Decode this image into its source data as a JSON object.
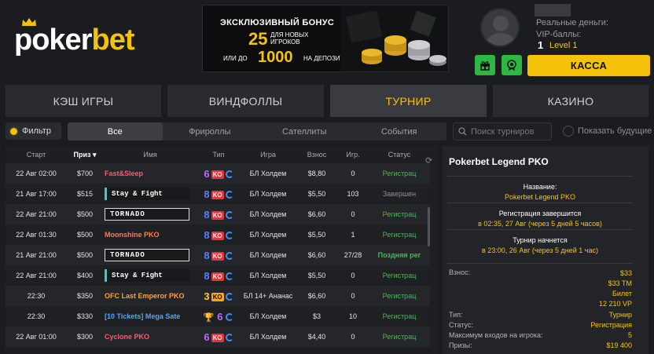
{
  "brand": {
    "logo_part1": "poker",
    "logo_part2": "bet",
    "accent": "#f5c20a",
    "green": "#2fb743"
  },
  "banner": {
    "line1": "ЭКСКЛЮЗИВНЫЙ БОНУС",
    "amount1": "25",
    "amount1_desc": "ДЛЯ НОВЫХ ИГРОКОВ",
    "prefix2": "ИЛИ ДО",
    "amount2": "1000",
    "amount2_desc": "НА ДЕПОЗИТ"
  },
  "account": {
    "money_label": "Реальные деньги:",
    "vip_label": "VIP-баллы:",
    "vip_points": "1",
    "level": "Level 1",
    "kassa_label": "КАССА",
    "gift_icon": "gift-icon",
    "badge_icon": "badge-icon"
  },
  "nav": {
    "tabs": [
      {
        "label": "КЭШ ИГРЫ"
      },
      {
        "label": "ВИНДФОЛЛЫ"
      },
      {
        "label": "ТУРНИР"
      },
      {
        "label": "КАЗИНО"
      }
    ],
    "active": "ТУРНИР"
  },
  "filter": {
    "label": "Фильтр",
    "subtabs": [
      "Все",
      "Фрироллы",
      "Сателлиты",
      "События"
    ],
    "active_subtab": "Все",
    "search_placeholder": "Поиск турниров",
    "show_future": "Показать будущие"
  },
  "table": {
    "columns": [
      "Старт",
      "Приз",
      "Имя",
      "Тип",
      "Игра",
      "Взнос",
      "Игр.",
      "Статус"
    ],
    "sort_column": "Приз",
    "rows": [
      {
        "start": "22 Авг 02:00",
        "prize": "$700",
        "name": "Fast&Sleep",
        "type_num": "6",
        "type_flags": "KO",
        "game": "БЛ Холдем",
        "buyin": "$8,80",
        "players": "0",
        "status": "Регистрац"
      },
      {
        "start": "21 Авг 17:00",
        "prize": "$515",
        "name": "Stay & Fight",
        "type_num": "8",
        "type_flags": "KO",
        "game": "БЛ Холдем",
        "buyin": "$5,50",
        "players": "103",
        "status": "Завершен"
      },
      {
        "start": "22 Авг 21:00",
        "prize": "$500",
        "name": "TORNADO",
        "type_num": "8",
        "type_flags": "KO",
        "game": "БЛ Холдем",
        "buyin": "$6,60",
        "players": "0",
        "status": "Регистрац"
      },
      {
        "start": "22 Авг 01:30",
        "prize": "$500",
        "name": "Moonshine PKO",
        "type_num": "8",
        "type_flags": "KO",
        "game": "БЛ Холдем",
        "buyin": "$5,50",
        "players": "1",
        "status": "Регистрац"
      },
      {
        "start": "21 Авг 21:00",
        "prize": "$500",
        "name": "TORNADO",
        "type_num": "8",
        "type_flags": "KO",
        "game": "БЛ Холдем",
        "buyin": "$6,60",
        "players": "27/28",
        "status": "Поздняя рег"
      },
      {
        "start": "22 Авг 21:00",
        "prize": "$400",
        "name": "Stay & Fight",
        "type_num": "8",
        "type_flags": "KO",
        "game": "БЛ Холдем",
        "buyin": "$5,50",
        "players": "0",
        "status": "Регистрац"
      },
      {
        "start": "22:30",
        "prize": "$350",
        "name": "OFC Last Emperor PKO",
        "type_num": "3",
        "type_flags": "KO",
        "game": "БЛ 14+ Ананас",
        "buyin": "$6,60",
        "players": "0",
        "status": "Регистрац"
      },
      {
        "start": "22:30",
        "prize": "$330",
        "name": "[10 Tickets] Mega Sate",
        "type_num": "6",
        "type_flags": "",
        "game": "БЛ Холдем",
        "buyin": "$3",
        "players": "10",
        "status": "Регистрац"
      },
      {
        "start": "22 Авг 01:00",
        "prize": "$300",
        "name": "Cyclone PKO",
        "type_num": "6",
        "type_flags": "KO",
        "game": "БЛ Холдем",
        "buyin": "$4,40",
        "players": "0",
        "status": "Регистрац"
      }
    ]
  },
  "detail": {
    "title": "Pokerbet Legend PKO",
    "name_label": "Название:",
    "name_value": "Pokerbet Legend PKO",
    "reg_label": "Регистрация завершится",
    "reg_value": "в 02:35, 27 Авг (через 5 дней 5 часов)",
    "start_label": "Турнир начнется",
    "start_value": "в 23:00, 26 Авг (через 5 дней 1 час)",
    "buyin_label": "Взнос:",
    "buyin_values": [
      "$33",
      "$33 TM",
      "Билет",
      "12 210 VP"
    ],
    "type_label": "Тип:",
    "type_value": "Турнир",
    "status_label": "Статус:",
    "status_value": "Регистрация",
    "max_label": "Максимум входов на игрока:",
    "max_value": "5",
    "prizes_label": "Призы:",
    "prizes_value": "$19 400"
  }
}
